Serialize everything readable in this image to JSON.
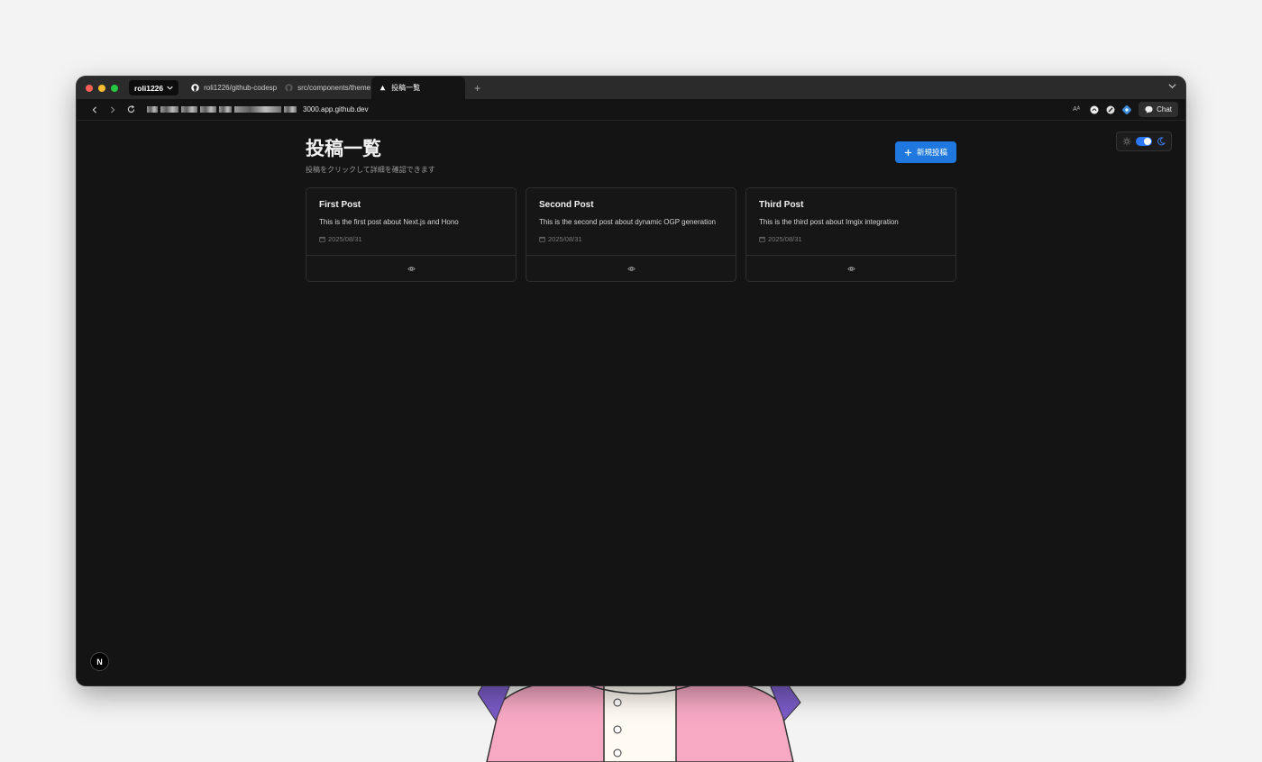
{
  "browser": {
    "profile_name": "roli1226",
    "tabs": [
      {
        "label": "roli1226/github-codesp",
        "icon": "github-icon",
        "active": false
      },
      {
        "label": "src/components/theme",
        "icon": "github-icon",
        "active": false
      },
      {
        "label": "投稿一覧",
        "icon": "triangle-icon",
        "active": true
      }
    ],
    "url_visible": "3000.app.github.dev",
    "chat_label": "Chat",
    "reader_label": "Aᴬ"
  },
  "page": {
    "title": "投稿一覧",
    "subtitle": "投稿をクリックして詳細を確認できます",
    "new_post_label": "新規投稿",
    "posts": [
      {
        "title": "First Post",
        "description": "This is the first post about Next.js and Hono",
        "date": "2025/08/31"
      },
      {
        "title": "Second Post",
        "description": "This is the second post about dynamic OGP generation",
        "date": "2025/08/31"
      },
      {
        "title": "Third Post",
        "description": "This is the third post about Imgix integration",
        "date": "2025/08/31"
      }
    ],
    "next_badge": "N"
  },
  "colors": {
    "accent": "#1f78e0",
    "background": "#141414",
    "card_border": "#2e2e2e"
  }
}
